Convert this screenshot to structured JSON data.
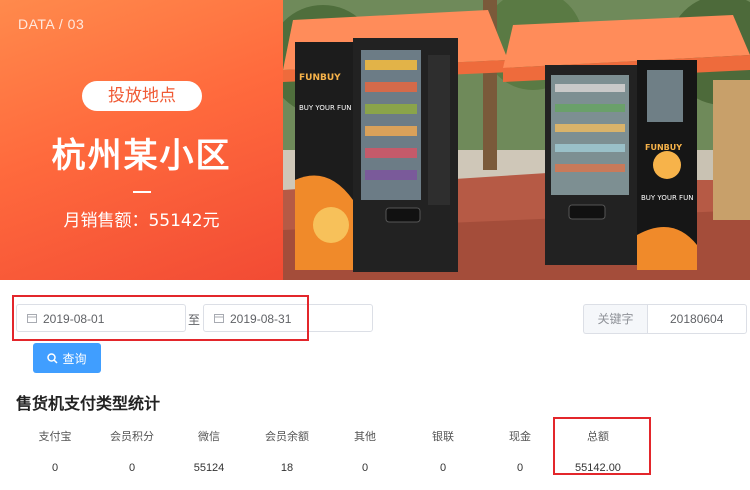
{
  "banner": {
    "data_label": "DATA / 03",
    "pill": "投放地点",
    "title": "杭州某小区",
    "sales": "月销售额：55142元",
    "photo": {
      "left_sign_1": "FUNBUY",
      "left_sign_2": "BUY YOUR FUN",
      "right_sign_1": "FUNBUY",
      "right_sign_2": "BUY YOUR FUN"
    }
  },
  "filters": {
    "start_date": "2019-08-01",
    "to_label": "至",
    "end_date": "2019-08-31",
    "keyword_label": "关键字",
    "keyword_value": "20180604",
    "query_button": "查询"
  },
  "stats": {
    "title": "售货机支付类型统计",
    "columns": [
      {
        "header": "支付宝",
        "value": "0"
      },
      {
        "header": "会员积分",
        "value": "0"
      },
      {
        "header": "微信",
        "value": "55124"
      },
      {
        "header": "会员余额",
        "value": "18"
      },
      {
        "header": "其他",
        "value": "0"
      },
      {
        "header": "银联",
        "value": "0"
      },
      {
        "header": "现金",
        "value": "0"
      },
      {
        "header": "总额",
        "value": "55142.00"
      }
    ]
  },
  "colors": {
    "banner_gradient_start": "#ff8a4c",
    "banner_gradient_end": "#f24b34",
    "highlight_red": "#e3262b",
    "primary_button": "#409eff"
  }
}
